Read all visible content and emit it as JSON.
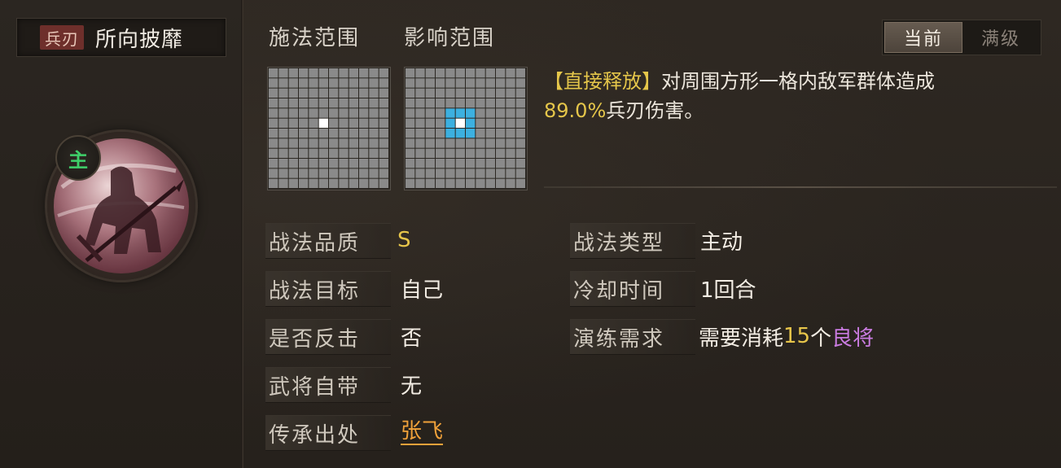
{
  "skill": {
    "tag": "兵刃",
    "name": "所向披靡",
    "role_badge": "主"
  },
  "tabs": {
    "cast_range": "施法范围",
    "effect_range": "影响范围"
  },
  "grids": {
    "size": 12,
    "cast": {
      "center": [
        5,
        5
      ],
      "highlight": []
    },
    "effect": {
      "center": [
        5,
        5
      ],
      "highlight_radius": 1
    },
    "colors": {
      "cell": "#8a8a8a",
      "line": "#4d4d4d",
      "center": "#ffffff",
      "highlight": "#3cb0e0"
    }
  },
  "level_toggle": {
    "current": "当前",
    "max": "满级",
    "selected": "current"
  },
  "description": {
    "prefix": "【直接释放】",
    "text": "对周围方形一格内敌军群体造成",
    "value": "89.0%",
    "suffix": "兵刃伤害。"
  },
  "attributes": {
    "quality_label": "战法品质",
    "quality_value": "S",
    "target_label": "战法目标",
    "target_value": "自己",
    "counter_label": "是否反击",
    "counter_value": "否",
    "innate_label": "武将自带",
    "innate_value": "无",
    "origin_label": "传承出处",
    "origin_value": "张飞",
    "type_label": "战法类型",
    "type_value": "主动",
    "cooldown_label": "冷却时间",
    "cooldown_value": "1回合",
    "train_label": "演练需求",
    "train_prefix": "需要消耗",
    "train_count": "15",
    "train_unit": "个",
    "train_item": "良将"
  },
  "accent_colors": {
    "gold": "#e7c54a",
    "purple": "#c97be0",
    "orange_link": "#f0a23a",
    "role_green": "#3fd06a"
  }
}
